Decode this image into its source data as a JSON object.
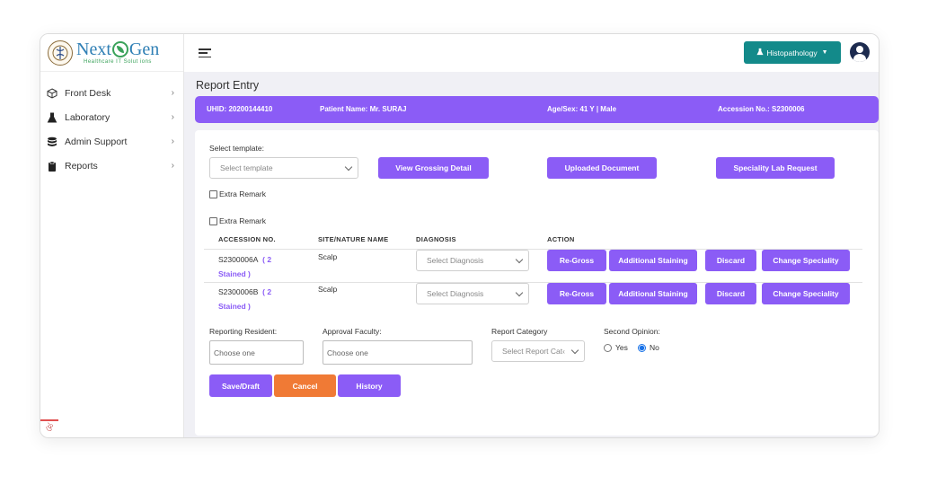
{
  "logo": {
    "name_left": "Next",
    "name_right": "Gen",
    "tagline": "Healthcare IT Solut ions"
  },
  "sidebar": {
    "items": [
      {
        "label": "Front Desk",
        "icon": "cube-icon"
      },
      {
        "label": "Laboratory",
        "icon": "flask-icon"
      },
      {
        "label": "Admin Support",
        "icon": "database-icon"
      },
      {
        "label": "Reports",
        "icon": "clipboard-icon"
      }
    ]
  },
  "header": {
    "department": "Histopathology"
  },
  "page": {
    "title": "Report Entry"
  },
  "patient": {
    "uhid": "UHID: 20200144410",
    "name": "Patient Name: Mr. SURAJ",
    "age_sex": "Age/Sex: 41 Y | Male",
    "accession": "Accession No.: S2300006"
  },
  "form": {
    "select_template_label": "Select template:",
    "select_template_placeholder": "Select template",
    "view_grossing": "View Grossing Detail",
    "uploaded_document": "Uploaded Document",
    "speciality_lab": "Speciality Lab Request",
    "extra_remark_1": "Extra Remark",
    "extra_remark_2": "Extra Remark"
  },
  "table": {
    "headers": [
      "ACCESSION NO.",
      "SITE/NATURE NAME",
      "DIAGNOSIS",
      "ACTION"
    ],
    "rows": [
      {
        "accession": "S2300006A",
        "stain_count": "( 2",
        "stain_label": "Stained )",
        "site": "Scalp",
        "diagnosis_placeholder": "Select Diagnosis"
      },
      {
        "accession": "S2300006B",
        "stain_count": "( 2",
        "stain_label": "Stained )",
        "site": "Scalp",
        "diagnosis_placeholder": "Select Diagnosis"
      }
    ],
    "actions": {
      "regross": "Re-Gross",
      "additional_staining": "Additional Staining",
      "discard": "Discard",
      "change_speciality": "Change Speciality"
    }
  },
  "bottom": {
    "reporting_resident_label": "Reporting Resident:",
    "reporting_resident_placeholder": "Choose one",
    "approval_faculty_label": "Approval Faculty:",
    "approval_faculty_placeholder": "Choose one",
    "report_category_label": "Report Category",
    "report_category_placeholder": "Select Report Cat‹",
    "second_opinion_label": "Second Opinion:",
    "yes": "Yes",
    "no": "No",
    "second_opinion_selected": "No"
  },
  "buttons": {
    "save": "Save/Draft",
    "cancel": "Cancel",
    "history": "History"
  },
  "colors": {
    "primary": "#8b5cf6",
    "teal": "#138a8a",
    "cancel": "#f07a35"
  }
}
